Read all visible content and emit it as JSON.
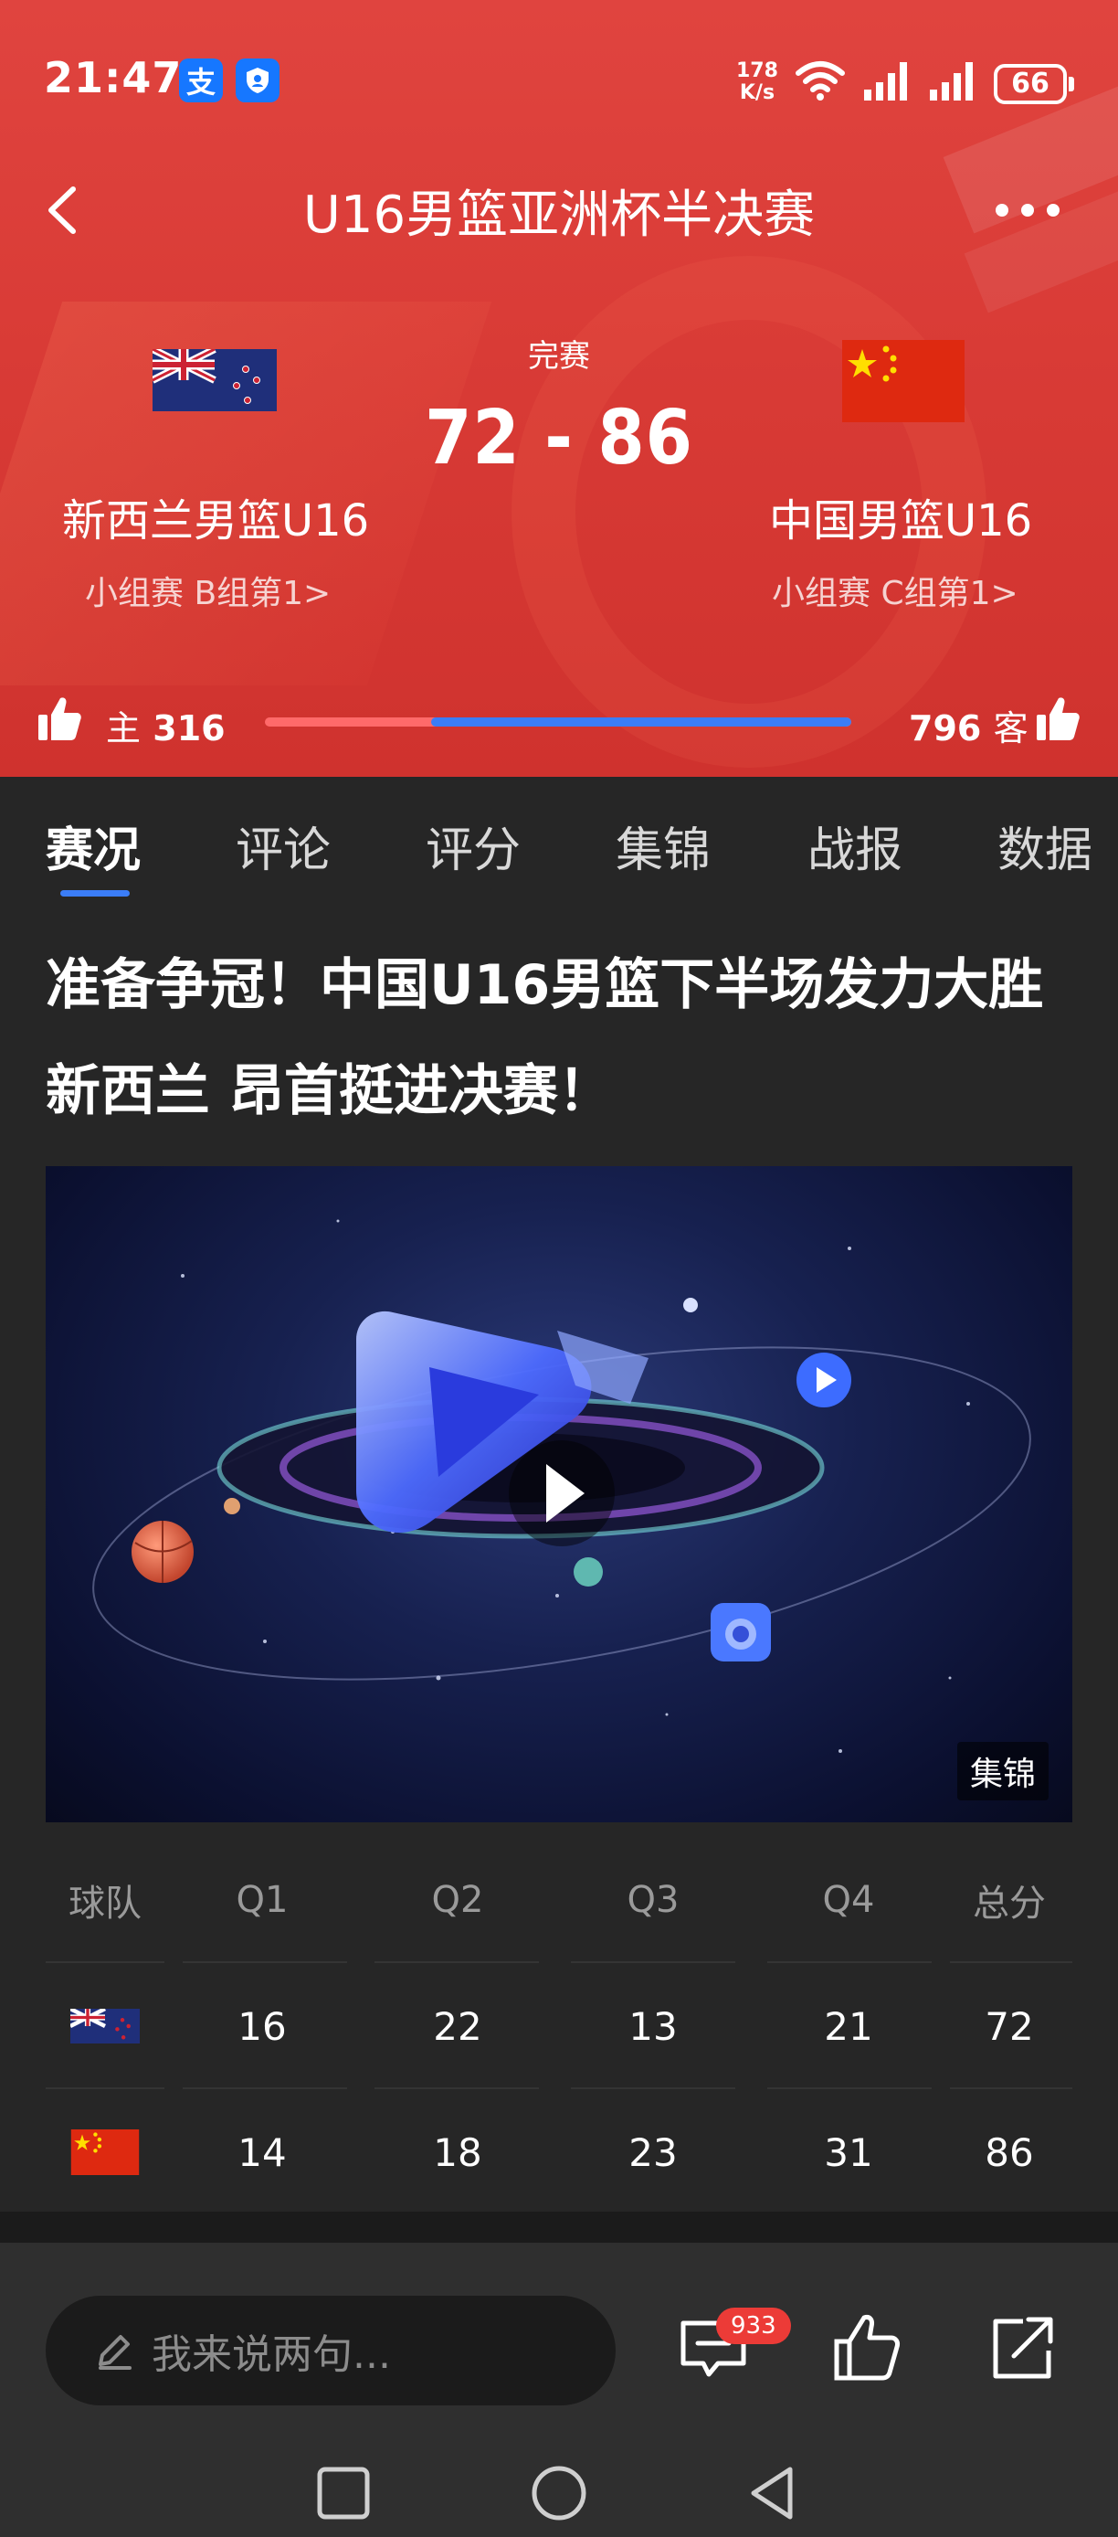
{
  "status_bar": {
    "time": "21:47",
    "app_badge_1": "支",
    "net_speed_value": "178",
    "net_speed_unit": "K/s",
    "battery": "66"
  },
  "header": {
    "title": "U16男篮亚洲杯半决赛"
  },
  "match": {
    "status": "完赛",
    "score": "72 - 86",
    "home": {
      "name": "新西兰男篮U16",
      "group": "小组赛 B组第1>",
      "flag_icon": "new-zealand-flag-icon"
    },
    "away": {
      "name": "中国男篮U16",
      "group": "小组赛 C组第1>",
      "flag_icon": "china-flag-icon"
    }
  },
  "votes": {
    "home_label": "主",
    "home_count": "316",
    "away_count": "796",
    "away_label": "客",
    "home_share": 0.284,
    "colors": {
      "home": "#ff6a6a",
      "away": "#3b7df7"
    }
  },
  "tabs": [
    {
      "label": "赛况",
      "active": true
    },
    {
      "label": "评论",
      "active": false
    },
    {
      "label": "评分",
      "active": false
    },
    {
      "label": "集锦",
      "active": false
    },
    {
      "label": "战报",
      "active": false
    },
    {
      "label": "数据",
      "active": false
    }
  ],
  "article": {
    "headline": "准备争冠！中国U16男篮下半场发力大胜新西兰 昂首挺进决赛！",
    "media_tag": "集锦"
  },
  "score_table": {
    "headers": [
      "球队",
      "Q1",
      "Q2",
      "Q3",
      "Q4",
      "总分"
    ],
    "rows": [
      {
        "flag": "new-zealand-flag-icon",
        "values": [
          "16",
          "22",
          "13",
          "21",
          "72"
        ]
      },
      {
        "flag": "china-flag-icon",
        "values": [
          "14",
          "18",
          "23",
          "31",
          "86"
        ]
      }
    ]
  },
  "bottom_bar": {
    "comment_placeholder": "我来说两句...",
    "comment_count": "933"
  },
  "theme": {
    "header_red": "#d93b36",
    "accent_blue": "#3b7df7",
    "background": "#262626"
  }
}
